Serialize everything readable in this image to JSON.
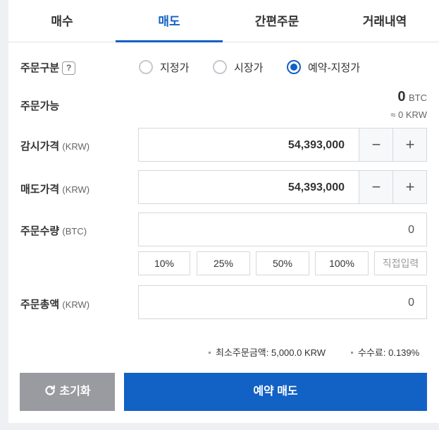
{
  "tabs": [
    "매수",
    "매도",
    "간편주문",
    "거래내역"
  ],
  "active_tab": "매도",
  "order_type": {
    "label": "주문구분",
    "help_icon": "question-icon",
    "options": [
      "지정가",
      "시장가",
      "예약-지정가"
    ],
    "selected": "예약-지정가"
  },
  "available": {
    "label": "주문가능",
    "amount": "0",
    "currency": "BTC",
    "approx_symbol": "≈",
    "krw_amount": "0",
    "krw_unit": "KRW"
  },
  "watch_price": {
    "label": "감시가격",
    "unit": "(KRW)",
    "value": "54,393,000"
  },
  "sell_price": {
    "label": "매도가격",
    "unit": "(KRW)",
    "value": "54,393,000"
  },
  "quantity": {
    "label": "주문수량",
    "unit": "(BTC)",
    "value": "0"
  },
  "percent_buttons": [
    "10%",
    "25%",
    "50%",
    "100%",
    "직접입력"
  ],
  "total": {
    "label": "주문총액",
    "unit": "(KRW)",
    "value": "0"
  },
  "notes": {
    "min_order": "최소주문금액: 5,000.0 KRW",
    "fee": "수수료: 0.139%"
  },
  "buttons": {
    "reset": "초기화",
    "submit": "예약 매도"
  },
  "colors": {
    "accent": "#1261c4",
    "reset_bg": "#999ba0"
  }
}
